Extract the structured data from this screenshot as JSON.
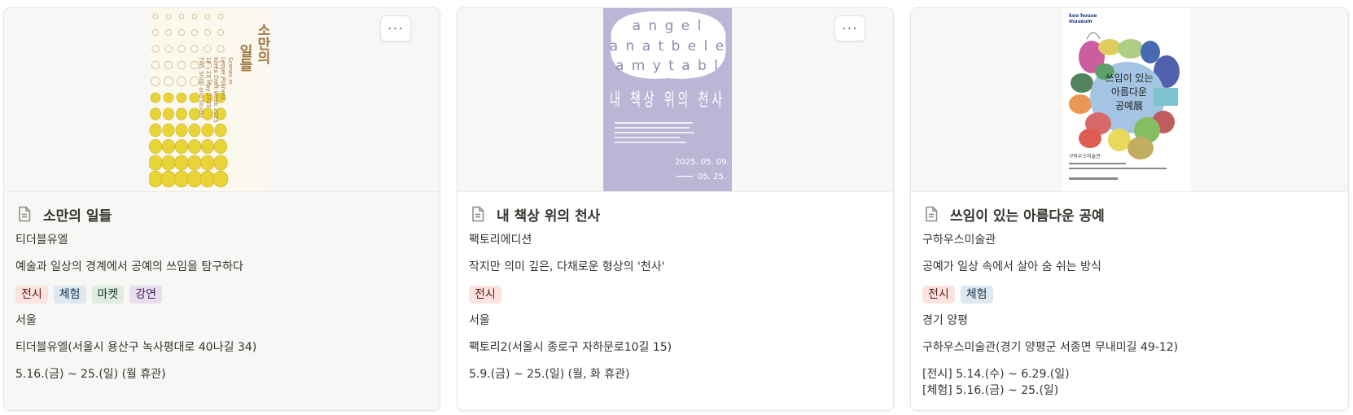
{
  "cards": [
    {
      "title": "소만의 일들",
      "venue": "티더블유엘",
      "description": "예술과 일상의 경계에서 공예의 쓰임을 탐구하다",
      "tags": [
        {
          "label": "전시",
          "bg": "#fbe4e0",
          "fg": "#5d1715"
        },
        {
          "label": "체험",
          "bg": "#dde8f1",
          "fg": "#183347"
        },
        {
          "label": "마켓",
          "bg": "#e1ece0",
          "fg": "#1c3829"
        },
        {
          "label": "강연",
          "bg": "#e8def0",
          "fg": "#412454"
        }
      ],
      "region": "서울",
      "address": "티더블유엘(서울시 용산구 녹사평대로 40나길 34)",
      "dates": [
        "5.16.(금) ~ 25.(일) (월 휴관)"
      ],
      "poster": {
        "title_vertical_1": "소만의",
        "title_vertical_2": "일들",
        "subtitle_lines": [
          "Scenes in",
          "Lesser Fullness",
          "Korea Craft Week 2025",
          "16 – 25 May 2025",
          "TWL Shop and Studio"
        ],
        "accent": "#e8d437",
        "text_color": "#a27742"
      }
    },
    {
      "title": "내 책상 위의 천사",
      "venue": "팩토리에디션",
      "description": "작지만 의미 깊은, 다채로운 형상의 '천사'",
      "tags": [
        {
          "label": "전시",
          "bg": "#fbe4e0",
          "fg": "#5d1715"
        }
      ],
      "region": "서울",
      "address": "팩토리2(서울시 종로구 자하문로10길 15)",
      "dates": [
        "5.9.(금) ~ 25.(일) (월, 화 휴관)"
      ],
      "poster": {
        "cloud_text": [
          "a n g e l",
          "a n a t b e l e",
          "a m y t a b l"
        ],
        "korean_title": "내 책상 위의 천사",
        "date_start": "2025. 05. 09.",
        "date_end": "05. 25.",
        "bg": "#bbb6d6"
      }
    },
    {
      "title": "쓰임이 있는 아름다운 공예",
      "venue": "구하우스미술관",
      "description": "공예가 일상 속에서 살아 숨 쉬는 방식",
      "tags": [
        {
          "label": "전시",
          "bg": "#fbe4e0",
          "fg": "#5d1715"
        },
        {
          "label": "체험",
          "bg": "#dde8f1",
          "fg": "#183347"
        }
      ],
      "region": "경기 양평",
      "address": "구하우스미술관(경기 양평군 서종면 무내미길 49-12)",
      "dates": [
        "[전시] 5.14.(수) ~ 6.29.(일)",
        "[체험] 5.16.(금) ~ 25.(일)"
      ],
      "poster": {
        "logo_lines": [
          "koo house",
          "museum"
        ],
        "overlay_lines": [
          "쓰임이 있는",
          "아름다운",
          "공예展"
        ],
        "footer": "구하우스미술관"
      }
    }
  ],
  "more_icon": "ellipsis-icon",
  "page_icon": "document-icon"
}
